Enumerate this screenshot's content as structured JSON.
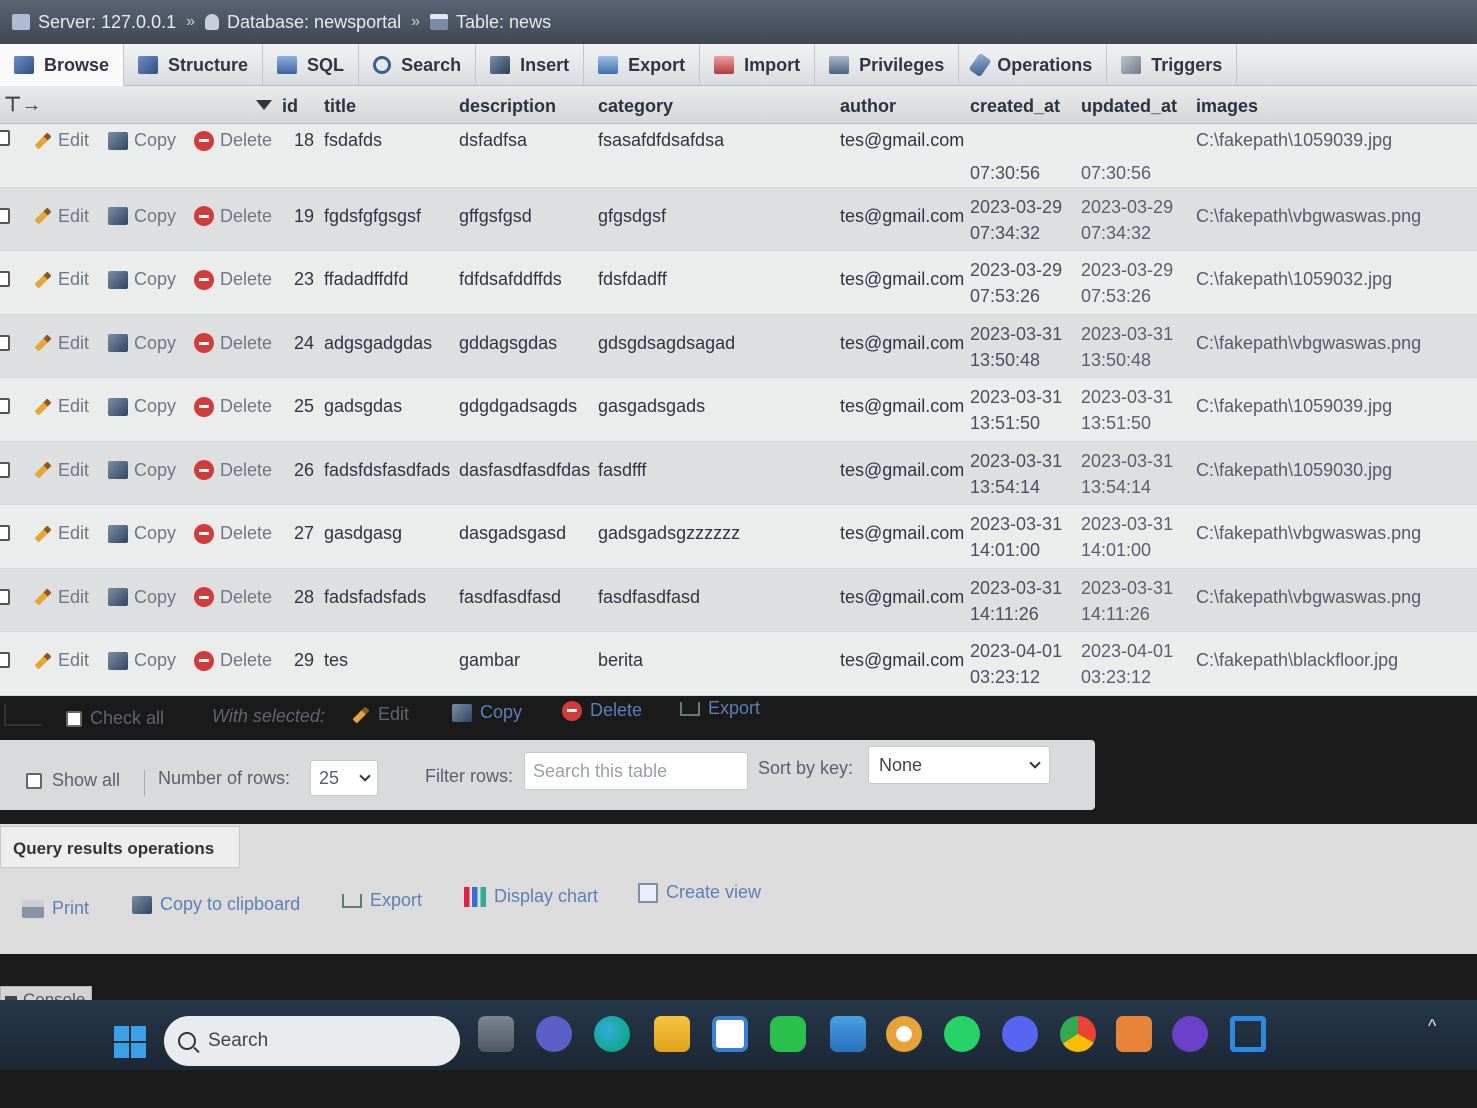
{
  "breadcrumb": {
    "server": "Server: 127.0.0.1",
    "database": "Database: newsportal",
    "table": "Table: news",
    "separator": "»"
  },
  "tabs": [
    {
      "label": "Browse",
      "icon": "browse-icon",
      "active": true
    },
    {
      "label": "Structure",
      "icon": "structure-icon"
    },
    {
      "label": "SQL",
      "icon": "sql-icon"
    },
    {
      "label": "Search",
      "icon": "search-icon"
    },
    {
      "label": "Insert",
      "icon": "insert-icon"
    },
    {
      "label": "Export",
      "icon": "export-icon"
    },
    {
      "label": "Import",
      "icon": "import-icon"
    },
    {
      "label": "Privileges",
      "icon": "privileges-icon"
    },
    {
      "label": "Operations",
      "icon": "operations-icon"
    },
    {
      "label": "Triggers",
      "icon": "triggers-icon"
    }
  ],
  "table": {
    "columns": [
      "id",
      "title",
      "description",
      "category",
      "author",
      "created_at",
      "updated_at",
      "images"
    ],
    "actions": {
      "edit": "Edit",
      "copy": "Copy",
      "delete": "Delete"
    },
    "rows": [
      {
        "id": "18",
        "title": "fsdafds",
        "description": "dsfadfsa",
        "category": "fsasafdfdsafdsa",
        "author": "tes@gmail.com",
        "created_date": "",
        "created_time": "07:30:56",
        "updated_date": "",
        "updated_time": "07:30:56",
        "images": "C:\\fakepath\\1059039.jpg"
      },
      {
        "id": "19",
        "title": "fgdsfgfgsgsf",
        "description": "gffgsfgsd",
        "category": "gfgsdgsf",
        "author": "tes@gmail.com",
        "created_date": "2023-03-29",
        "created_time": "07:34:32",
        "updated_date": "2023-03-29",
        "updated_time": "07:34:32",
        "images": "C:\\fakepath\\vbgwaswas.png"
      },
      {
        "id": "23",
        "title": "ffadadffdfd",
        "description": "fdfdsafddffds",
        "category": "fdsfdadff",
        "author": "tes@gmail.com",
        "created_date": "2023-03-29",
        "created_time": "07:53:26",
        "updated_date": "2023-03-29",
        "updated_time": "07:53:26",
        "images": "C:\\fakepath\\1059032.jpg"
      },
      {
        "id": "24",
        "title": "adgsgadgdas",
        "description": "gddagsgdas",
        "category": "gdsgdsagdsagad",
        "author": "tes@gmail.com",
        "created_date": "2023-03-31",
        "created_time": "13:50:48",
        "updated_date": "2023-03-31",
        "updated_time": "13:50:48",
        "images": "C:\\fakepath\\vbgwaswas.png"
      },
      {
        "id": "25",
        "title": "gadsgdas",
        "description": "gdgdgadsagds",
        "category": "gasgadsgads",
        "author": "tes@gmail.com",
        "created_date": "2023-03-31",
        "created_time": "13:51:50",
        "updated_date": "2023-03-31",
        "updated_time": "13:51:50",
        "images": "C:\\fakepath\\1059039.jpg"
      },
      {
        "id": "26",
        "title": "fadsfdsfasdfads",
        "description": "dasfasdfasdfdas",
        "category": "fasdfff",
        "author": "tes@gmail.com",
        "created_date": "2023-03-31",
        "created_time": "13:54:14",
        "updated_date": "2023-03-31",
        "updated_time": "13:54:14",
        "images": "C:\\fakepath\\1059030.jpg"
      },
      {
        "id": "27",
        "title": "gasdgasg",
        "description": "dasgadsgasd",
        "category": "gadsgadsgzzzzzz",
        "author": "tes@gmail.com",
        "created_date": "2023-03-31",
        "created_time": "14:01:00",
        "updated_date": "2023-03-31",
        "updated_time": "14:01:00",
        "images": "C:\\fakepath\\vbgwaswas.png"
      },
      {
        "id": "28",
        "title": "fadsfadsfads",
        "description": "fasdfasdfasd",
        "category": "fasdfasdfasd",
        "author": "tes@gmail.com",
        "created_date": "2023-03-31",
        "created_time": "14:11:26",
        "updated_date": "2023-03-31",
        "updated_time": "14:11:26",
        "images": "C:\\fakepath\\vbgwaswas.png"
      },
      {
        "id": "29",
        "title": "tes",
        "description": "gambar",
        "category": "berita",
        "author": "tes@gmail.com",
        "created_date": "2023-04-01",
        "created_time": "03:23:12",
        "updated_date": "2023-04-01",
        "updated_time": "03:23:12",
        "images": "C:\\fakepath\\blackfloor.jpg"
      }
    ]
  },
  "with_selected": {
    "check_all": "Check all",
    "label": "With selected:",
    "edit": "Edit",
    "copy": "Copy",
    "delete": "Delete",
    "export": "Export"
  },
  "navigation": {
    "show_all": "Show all",
    "rows_label": "Number of rows:",
    "rows_value": "25",
    "filter_label": "Filter rows:",
    "filter_placeholder": "Search this table",
    "sort_label": "Sort by key:",
    "sort_value": "None"
  },
  "query_ops": {
    "title": "Query results operations",
    "print": "Print",
    "copy_clipboard": "Copy to clipboard",
    "export": "Export",
    "display_chart": "Display chart",
    "create_view": "Create view"
  },
  "console": {
    "label": "Console"
  },
  "taskbar": {
    "search": "Search"
  }
}
